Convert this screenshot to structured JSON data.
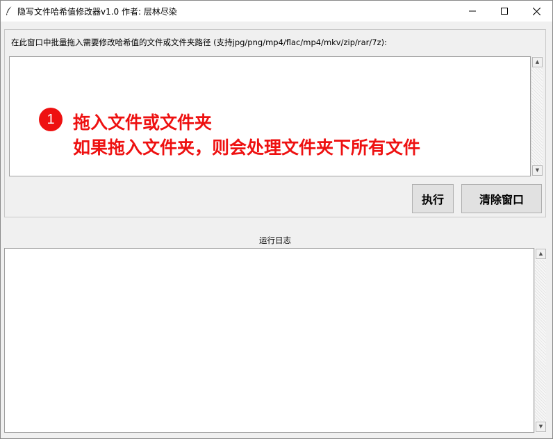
{
  "window": {
    "title": "隐写文件哈希值修改器v1.0 作者: 层林尽染",
    "icon": "feather-icon",
    "controls": [
      "minimize-icon",
      "maximize-icon",
      "close-icon"
    ]
  },
  "input_frame": {
    "label": "在此窗口中批量拖入需要修改哈希值的文件或文件夹路径 (支持jpg/png/mp4/flac/mp4/mkv/zip/rar/7z):",
    "value": ""
  },
  "annotation": {
    "badge": "1",
    "line1": "拖入文件或文件夹",
    "line2": "如果拖入文件夹，则会处理文件夹下所有文件",
    "color": "#ee1111"
  },
  "buttons": {
    "execute": "执行",
    "clear": "清除窗口"
  },
  "log": {
    "label": "运行日志",
    "value": ""
  }
}
